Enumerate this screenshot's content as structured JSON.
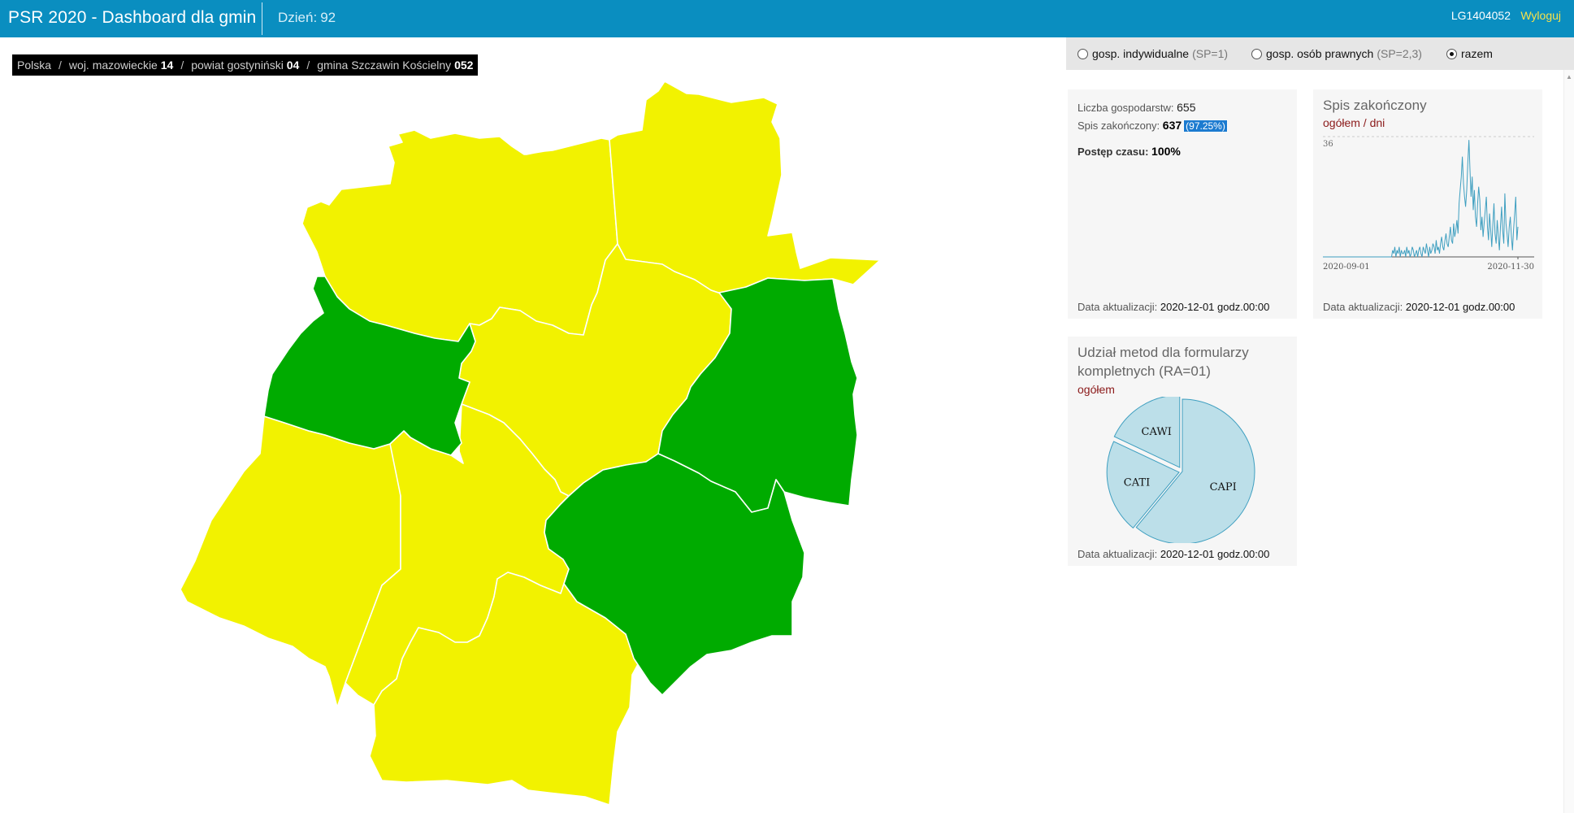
{
  "header": {
    "title": "PSR 2020 - Dashboard dla gmin",
    "day_label": "Dzień:",
    "day_value": "92",
    "user_id": "LG1404052",
    "logout_label": "Wyloguj"
  },
  "breadcrumb": {
    "country": "Polska",
    "voivodeship_label": "woj. mazowieckie",
    "voivodeship_code": "14",
    "county_label": "powiat gostyniński",
    "county_code": "04",
    "commune_label": "gmina Szczawin Kościelny",
    "commune_code": "052"
  },
  "colors": {
    "header_bg": "#0a8ec0",
    "map_yellow": "#f2f200",
    "map_green": "#00ab00",
    "chart_line": "#3f9fc0",
    "pie_fill": "#bcdfe9",
    "pie_stroke": "#3f9fc0"
  },
  "filters": {
    "options": [
      {
        "label": "gosp. indywidualne",
        "note": "(SP=1)",
        "selected": false
      },
      {
        "label": "gosp. osób prawnych",
        "note": "(SP=2,3)",
        "selected": false
      },
      {
        "label": "razem",
        "note": "",
        "selected": true
      }
    ]
  },
  "summary": {
    "households_label": "Liczba gospodarstw:",
    "households_value": "655",
    "completed_label": "Spis zakończony:",
    "completed_value": "637",
    "completed_pct": "(97.25%)",
    "time_progress_label": "Postęp czasu:",
    "time_progress_value": "100%",
    "updated_label": "Data aktualizacji:",
    "updated_value": "2020-12-01 godz.00:00"
  },
  "completion_chart": {
    "title": "Spis zakończony",
    "subtitle": "ogółem / dni",
    "updated_label": "Data aktualizacji:",
    "updated_value": "2020-12-01 godz.00:00"
  },
  "methods_chart": {
    "title_line1": "Udział metod dla formularzy",
    "title_line2": "kompletnych (RA=01)",
    "subtitle": "ogółem",
    "updated_label": "Data aktualizacji:",
    "updated_value": "2020-12-01 godz.00:00"
  },
  "chart_data": [
    {
      "type": "line",
      "x_start": "2020-09-01",
      "x_end": "2020-11-30",
      "xtick_labels": [
        "2020-09-01",
        "2020-11-30"
      ],
      "ylim": [
        0,
        36
      ],
      "ytick_labels": [
        "36"
      ],
      "values": [
        0,
        0,
        0,
        0,
        0,
        0,
        0,
        0,
        0,
        0,
        0,
        0,
        0,
        0,
        0,
        0,
        0,
        0,
        0,
        0,
        0,
        0,
        0,
        0,
        0,
        0,
        0,
        0,
        0,
        0,
        0,
        0,
        0,
        0,
        0,
        0,
        0,
        0,
        0,
        0,
        0,
        0,
        0,
        0,
        0,
        0,
        0,
        0,
        0,
        0,
        0,
        0,
        0,
        0,
        0,
        0,
        0,
        0,
        0,
        0,
        0,
        0,
        0,
        0,
        2,
        1,
        3,
        0,
        2,
        1,
        3,
        0,
        2,
        1,
        1,
        2,
        0,
        3,
        1,
        2,
        0,
        1,
        3,
        2,
        0,
        1,
        2,
        0,
        2,
        3,
        1,
        0,
        3,
        2,
        1,
        4,
        2,
        0,
        3,
        1,
        2,
        4,
        3,
        1,
        5,
        2,
        3,
        1,
        4,
        6,
        3,
        2,
        5,
        7,
        4,
        3,
        6,
        9,
        5,
        4,
        10,
        6,
        8,
        11,
        7,
        16,
        20,
        24,
        30,
        22,
        18,
        15,
        20,
        28,
        35,
        26,
        18,
        24,
        14,
        20,
        12,
        9,
        16,
        21,
        17,
        8,
        12,
        6,
        10,
        14,
        18,
        9,
        5,
        13,
        8,
        3,
        10,
        16,
        7,
        4,
        11,
        6,
        2,
        9,
        15,
        8,
        4,
        19,
        10,
        7,
        3,
        9,
        12,
        6,
        2,
        8,
        13,
        18,
        5,
        9
      ]
    },
    {
      "type": "pie",
      "categories": [
        "CAPI",
        "CATI",
        "CAWI"
      ],
      "values": [
        61,
        21,
        18
      ]
    }
  ]
}
